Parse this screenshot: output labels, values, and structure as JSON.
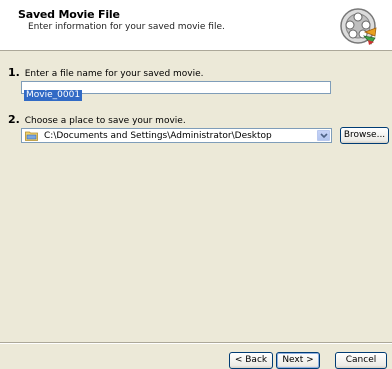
{
  "header": {
    "title": "Saved Movie File",
    "subtitle": "Enter information for your saved movie file.",
    "icon": "movie-maker-film-reel-icon"
  },
  "step1": {
    "number": "1.",
    "label": "Enter a file name for your saved movie.",
    "filename_value": "Movie_0001"
  },
  "step2": {
    "number": "2.",
    "label": "Choose a place to save your movie.",
    "location_value": "C:\\Documents and Settings\\Administrator\\Desktop",
    "location_icon": "folder-icon",
    "browse_label": "Browse..."
  },
  "footer": {
    "back_label": "< Back",
    "next_label": "Next >",
    "cancel_label": "Cancel"
  },
  "colors": {
    "dialog_bg": "#ece9d8",
    "header_bg": "#ffffff",
    "selection": "#316ac5",
    "input_border": "#7f9db9"
  }
}
